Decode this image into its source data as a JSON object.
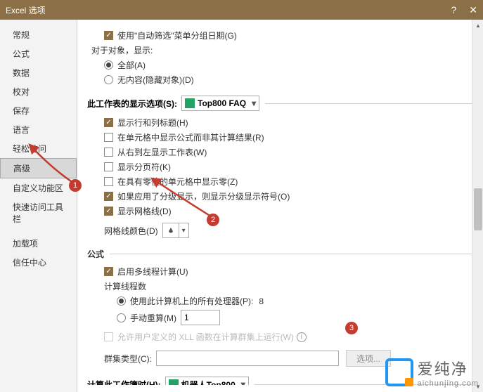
{
  "window": {
    "title": "Excel 选项"
  },
  "sidebar": {
    "items": [
      {
        "label": "常规"
      },
      {
        "label": "公式"
      },
      {
        "label": "数据"
      },
      {
        "label": "校对"
      },
      {
        "label": "保存"
      },
      {
        "label": "语言"
      },
      {
        "label": "轻松访问"
      },
      {
        "label": "高级",
        "selected": true
      },
      {
        "label": "自定义功能区"
      },
      {
        "label": "快速访问工具栏"
      },
      {
        "label": "加载项"
      },
      {
        "label": "信任中心"
      }
    ]
  },
  "content": {
    "autofilter_row": {
      "label": "使用\"自动筛选\"菜单分组日期(G)",
      "checked": true
    },
    "objects": {
      "title": "对于对象，显示:",
      "opt_all": "全部(A)",
      "opt_none": "无内容(隐藏对象)(D)",
      "selected": "all"
    },
    "worksheet_section": {
      "title": "此工作表的显示选项(S):",
      "combo_value": "Top800 FAQ"
    },
    "ws_opts": {
      "row_col_headers": {
        "label": "显示行和列标题(H)",
        "checked": true
      },
      "formulas_in_cells": {
        "label": "在单元格中显示公式而非其计算结果(R)",
        "checked": false
      },
      "right_to_left": {
        "label": "从右到左显示工作表(W)",
        "checked": false
      },
      "page_breaks": {
        "label": "显示分页符(K)",
        "checked": false
      },
      "zero_values": {
        "label": "在具有零值的单元格中显示零(Z)",
        "checked": false
      },
      "outline_symbols": {
        "label": "如果应用了分级显示，则显示分级显示符号(O)",
        "checked": true
      },
      "gridlines": {
        "label": "显示网格线(D)",
        "checked": true
      },
      "grid_color_label": "网格线颜色(D)"
    },
    "formula_section": {
      "title": "公式",
      "multithread": {
        "label": "启用多线程计算(U)",
        "checked": true
      },
      "threads_label": "计算线程数",
      "use_all": {
        "label": "使用此计算机上的所有处理器(P):",
        "value": "8",
        "selected": true
      },
      "manual": {
        "label": "手动重算(M)",
        "value": "1",
        "selected": false
      },
      "udf_cluster": {
        "label": "允许用户定义的 XLL 函数在计算群集上运行(W)",
        "checked": false
      },
      "cluster_type_label": "群集类型(C):",
      "cluster_btn": "选项..."
    },
    "workbook_section": {
      "title": "计算此工作簿时(H):",
      "combo_value": "机器人Top800"
    }
  },
  "annotations": {
    "a1": "1",
    "a2": "2",
    "a3": "3"
  },
  "watermark": {
    "cn": "爱纯净",
    "en": "aichunjing.com"
  }
}
